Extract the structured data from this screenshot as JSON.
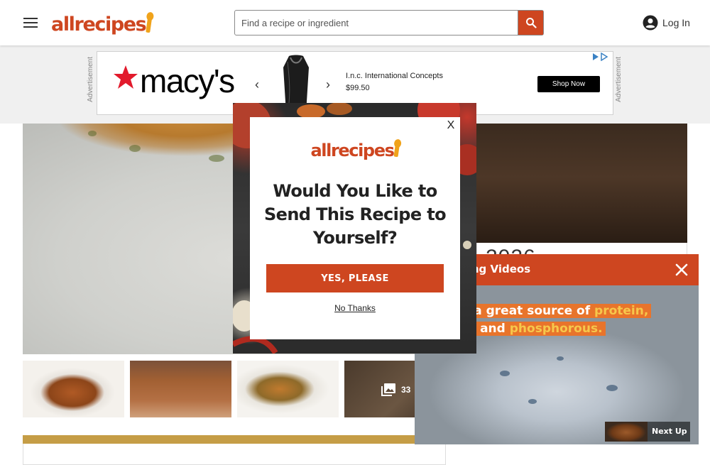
{
  "header": {
    "logo_text": "allrecipes",
    "search_placeholder": "Find a recipe or ingredient",
    "login_label": "Log In"
  },
  "ad": {
    "label": "Advertisement",
    "brand": "macy's",
    "product_name": "I.n.c. International Concepts",
    "price": "$99.50",
    "cta": "Shop Now"
  },
  "gallery": {
    "photo_count": "33"
  },
  "right_column": {
    "partial_text": "2026"
  },
  "modal": {
    "close_label": "X",
    "logo_text": "allrecipes",
    "heading": "Would You Like to Send This Recipe to Yourself?",
    "yes_label": "YES, PLEASE",
    "no_label": "No Thanks"
  },
  "video_popup": {
    "title": "ding Videos",
    "caption_line1_pre": "'s a great source of ",
    "caption_line1_hl": "protein,",
    "caption_line2_pre": "m, and ",
    "caption_line2_hl": "phosphorous.",
    "next_up_label": "Next Up"
  },
  "colors": {
    "brand": "#ce4620",
    "accent": "#f0a31b",
    "ingredient_bar": "#c59d46"
  }
}
